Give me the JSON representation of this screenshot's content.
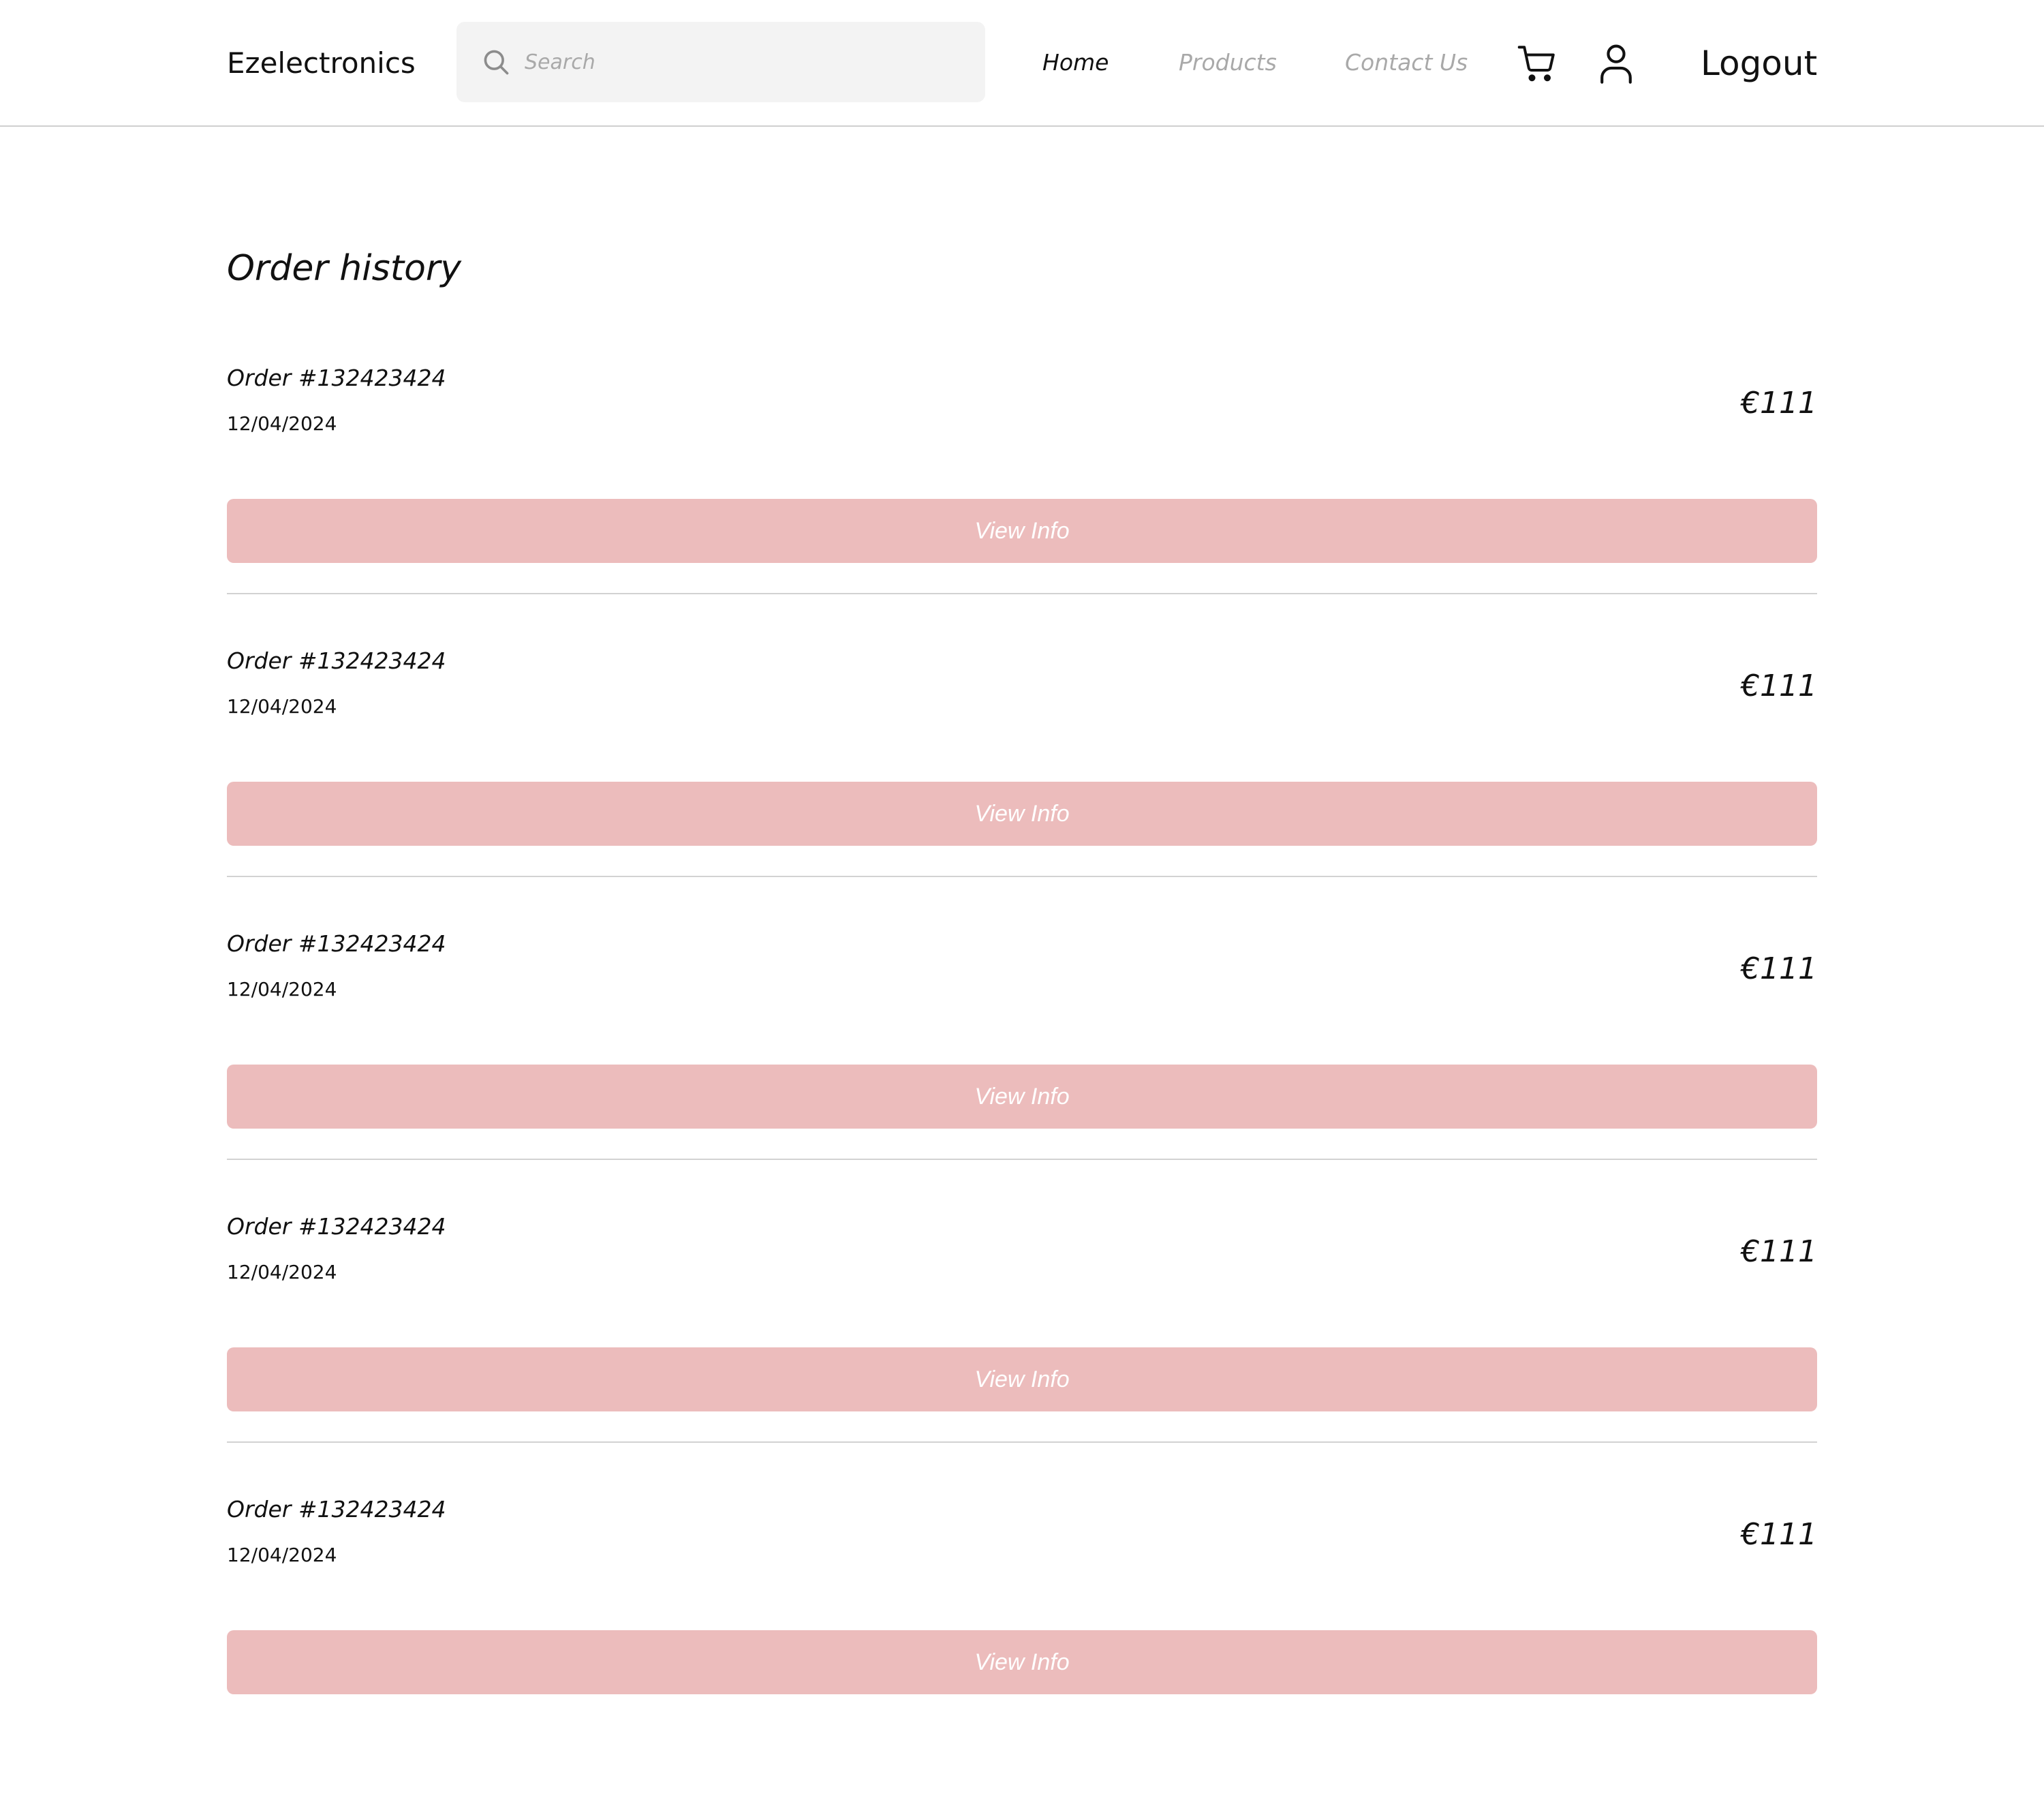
{
  "header": {
    "brand": "Ezelectronics",
    "search": {
      "placeholder": "Search",
      "icon": "search-icon"
    },
    "nav": [
      {
        "label": "Home",
        "active": true
      },
      {
        "label": "Products",
        "active": false
      },
      {
        "label": "Contact Us",
        "active": false
      }
    ],
    "icons": {
      "cart": "cart-icon",
      "user": "user-icon"
    },
    "logout_label": "Logout"
  },
  "main": {
    "title": "Order history",
    "orders": [
      {
        "number": "Order #132423424",
        "date": "12/04/2024",
        "price": "€111",
        "button": "View Info"
      },
      {
        "number": "Order #132423424",
        "date": "12/04/2024",
        "price": "€111",
        "button": "View Info"
      },
      {
        "number": "Order #132423424",
        "date": "12/04/2024",
        "price": "€111",
        "button": "View Info"
      },
      {
        "number": "Order #132423424",
        "date": "12/04/2024",
        "price": "€111",
        "button": "View Info"
      },
      {
        "number": "Order #132423424",
        "date": "12/04/2024",
        "price": "€111",
        "button": "View Info"
      }
    ]
  },
  "colors": {
    "button_bg": "#ecbcbc",
    "search_bg": "#f3f3f3",
    "muted_text": "#a9a9a9",
    "divider": "#d2d2d2"
  }
}
